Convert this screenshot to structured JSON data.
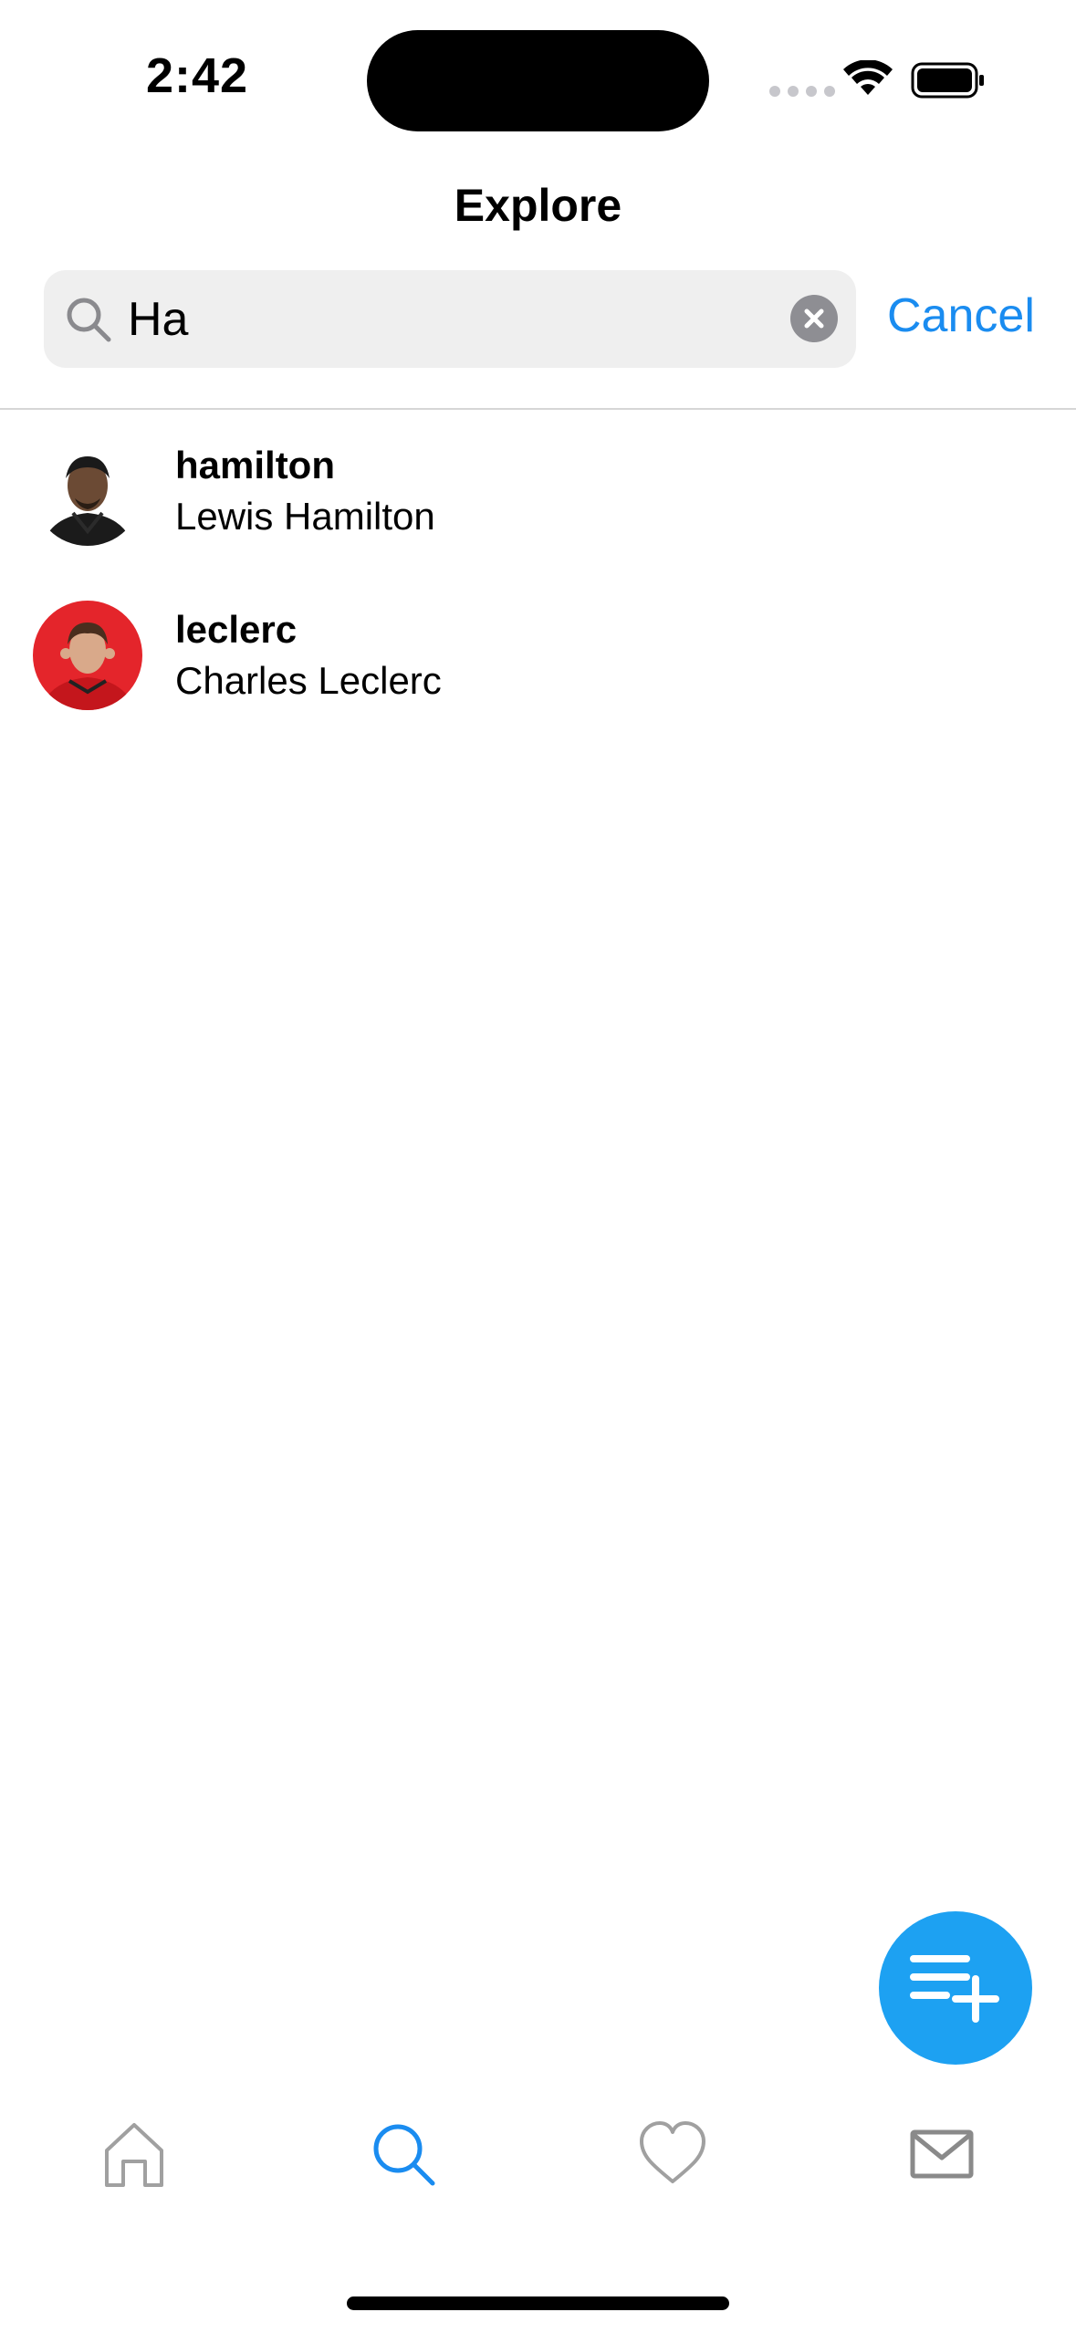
{
  "status_bar": {
    "time": "2:42"
  },
  "header": {
    "title": "Explore"
  },
  "search": {
    "value": "Ha",
    "cancel_label": "Cancel"
  },
  "results": [
    {
      "username": "hamilton",
      "full_name": "Lewis Hamilton"
    },
    {
      "username": "leclerc",
      "full_name": "Charles Leclerc"
    }
  ],
  "tab_bar": {
    "items": [
      {
        "icon": "home-icon",
        "active": false
      },
      {
        "icon": "search-icon",
        "active": true
      },
      {
        "icon": "heart-icon",
        "active": false
      },
      {
        "icon": "mail-icon",
        "active": false
      }
    ]
  },
  "colors": {
    "accent": "#1a8cf0",
    "fab": "#1da1f2",
    "inactive_icon": "#a0a0a0",
    "search_bg": "#efefef"
  },
  "icons": {
    "fab": "compose-list-plus-icon",
    "search_field": "magnifier-icon",
    "clear": "clear-circle-icon"
  }
}
